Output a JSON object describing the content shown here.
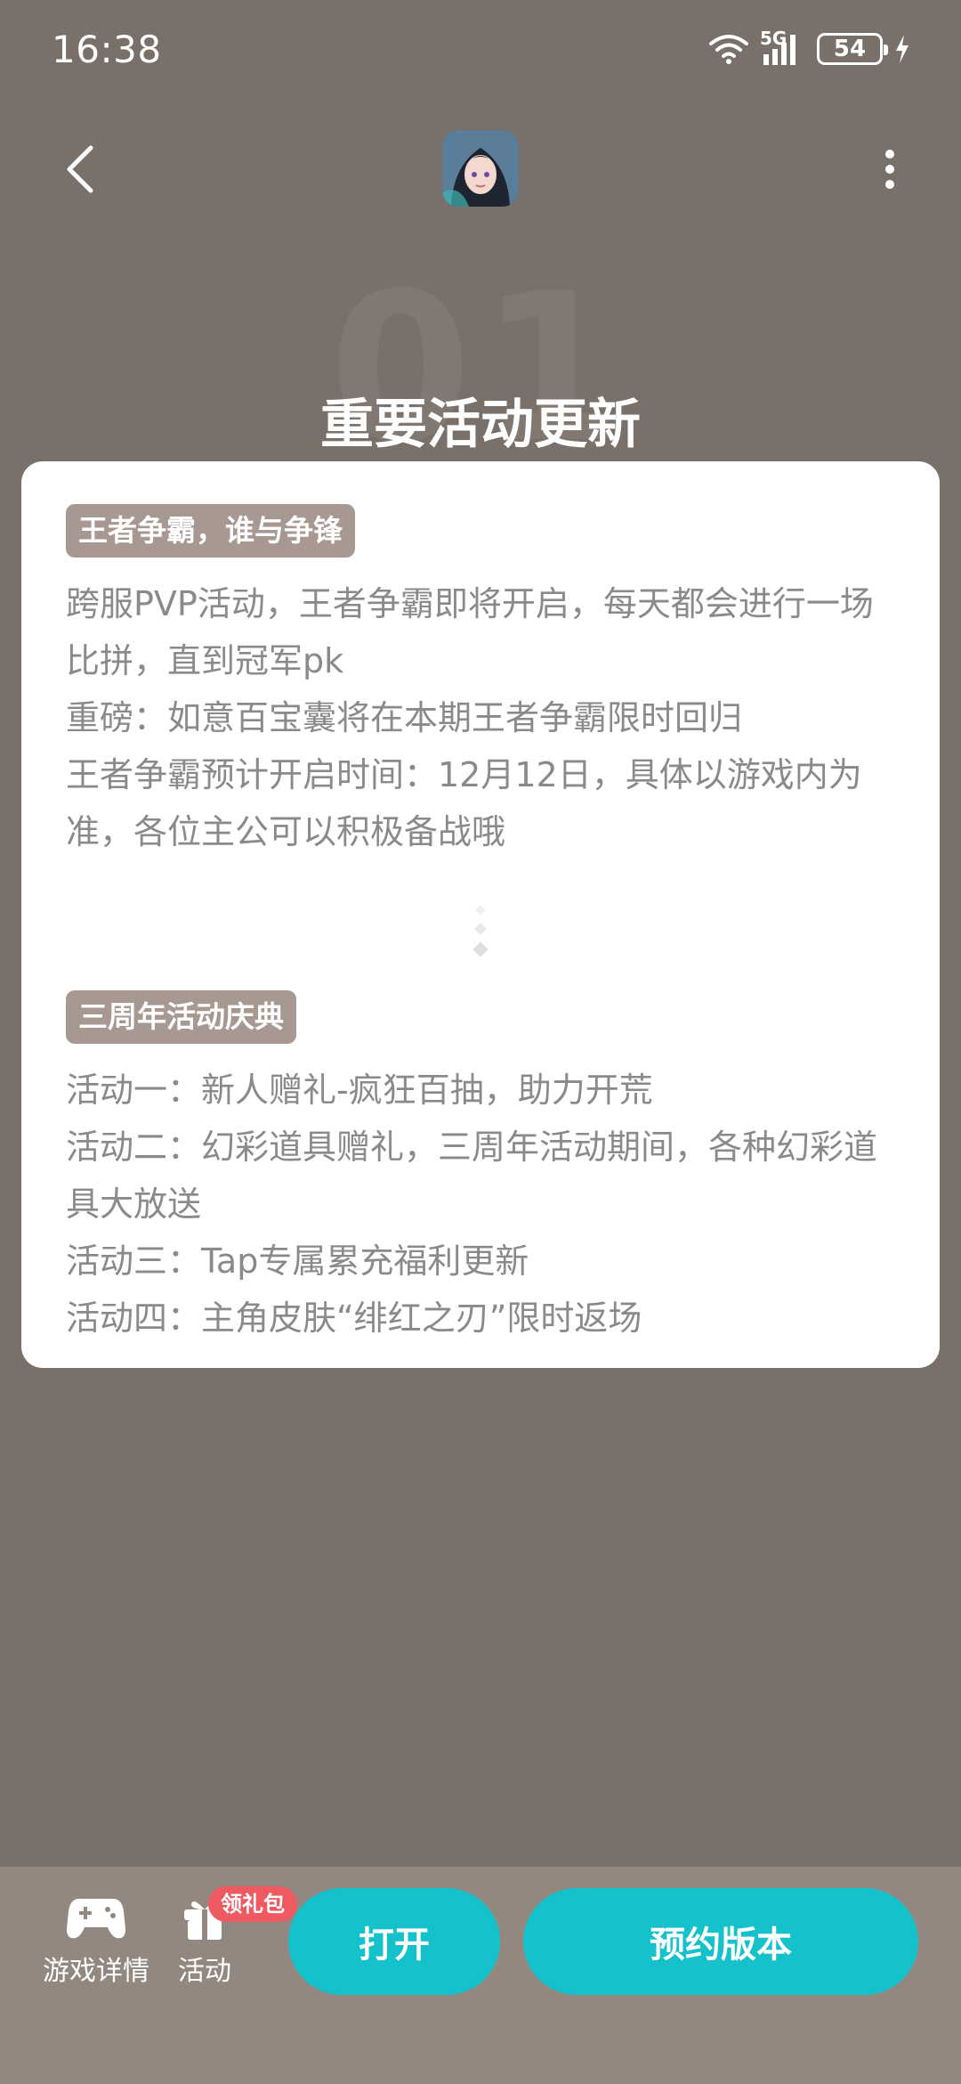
{
  "status_bar": {
    "time": "16:38",
    "network": "5G",
    "battery": "54"
  },
  "header": {
    "back_icon": "chevron-left-icon",
    "more_icon": "more-vertical-icon"
  },
  "section": {
    "number": "01",
    "title": "重要活动更新"
  },
  "card": {
    "blocks": [
      {
        "tag": "王者争霸，谁与争锋",
        "lines": [
          "跨服PVP活动，王者争霸即将开启，每天都会进行一场比拼，直到冠军pk",
          "重磅：如意百宝囊将在本期王者争霸限时回归",
          "王者争霸预计开启时间：12月12日，具体以游戏内为准，各位主公可以积极备战哦"
        ]
      },
      {
        "tag": "三周年活动庆典",
        "lines": [
          "活动一：新人赠礼-疯狂百抽，助力开荒",
          "活动二：幻彩道具赠礼，三周年活动期间，各种幻彩道具大放送",
          "活动三：Tap专属累充福利更新",
          "活动四：主角皮肤“绯红之刃”限时返场"
        ]
      }
    ]
  },
  "bottom_bar": {
    "game_detail_label": "游戏详情",
    "activity_label": "活动",
    "gift_badge": "领礼包",
    "open_button": "打开",
    "reserve_button": "预约版本"
  },
  "colors": {
    "background": "#7a706a",
    "accent": "#15c2cc",
    "tag": "#a79891",
    "badge": "#ef5a62"
  }
}
